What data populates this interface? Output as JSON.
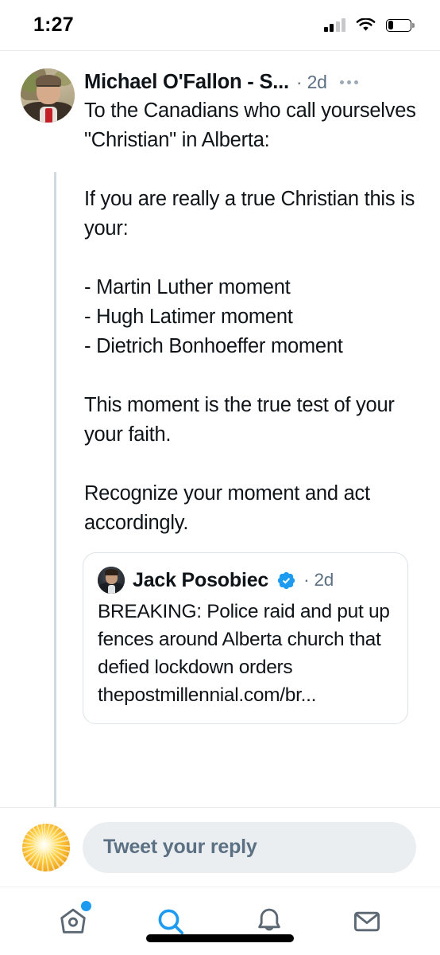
{
  "status_bar": {
    "time": "1:27",
    "cellular_icon": "cellular-signal-icon",
    "wifi_icon": "wifi-icon",
    "battery_icon": "battery-low-icon",
    "battery_level_pct": 25
  },
  "tweet": {
    "author_name": "Michael O'Fallon - S...",
    "timestamp": "· 2d",
    "more_icon": "more-options-icon",
    "avatar_alt": "man-with-glasses-red-tie-avatar",
    "text": "To the Canadians who call yourselves \"Christian\" in Alberta:\n\nIf you are really a true Christian this is your:\n\n- Martin Luther moment\n- Hugh Latimer moment\n- Dietrich Bonhoeffer moment\n\nThis moment is the true test of your your faith.\n\nRecognize your moment and act accordingly."
  },
  "quoted_tweet": {
    "author_name": "Jack Posobiec",
    "verified_icon": "verified-badge-icon",
    "verified_color": "#1D9BF0",
    "timestamp": "· 2d",
    "avatar_alt": "man-in-suit-dark-avatar",
    "text": "BREAKING: Police raid and put up fences around Alberta church that defied lockdown orders thepostmillennial.com/br..."
  },
  "reply_bar": {
    "avatar_alt": "sun-burst-avatar",
    "placeholder": "Tweet your reply"
  },
  "bottom_nav": {
    "items": [
      {
        "name": "home",
        "icon": "home-icon",
        "active": false,
        "badge": true
      },
      {
        "name": "search",
        "icon": "search-icon",
        "active": true,
        "badge": false
      },
      {
        "name": "notifications",
        "icon": "bell-icon",
        "active": false,
        "badge": false
      },
      {
        "name": "messages",
        "icon": "envelope-icon",
        "active": false,
        "badge": false
      }
    ],
    "active_color": "#1D9BF0",
    "inactive_color": "#5B6772"
  },
  "colors": {
    "text_primary": "#0F1419",
    "text_secondary": "#5B7083",
    "accent": "#1D9BF0",
    "divider": "#E9EBEE",
    "pill_bg": "#EBEEF0",
    "thread_line": "#CFD9DE"
  }
}
